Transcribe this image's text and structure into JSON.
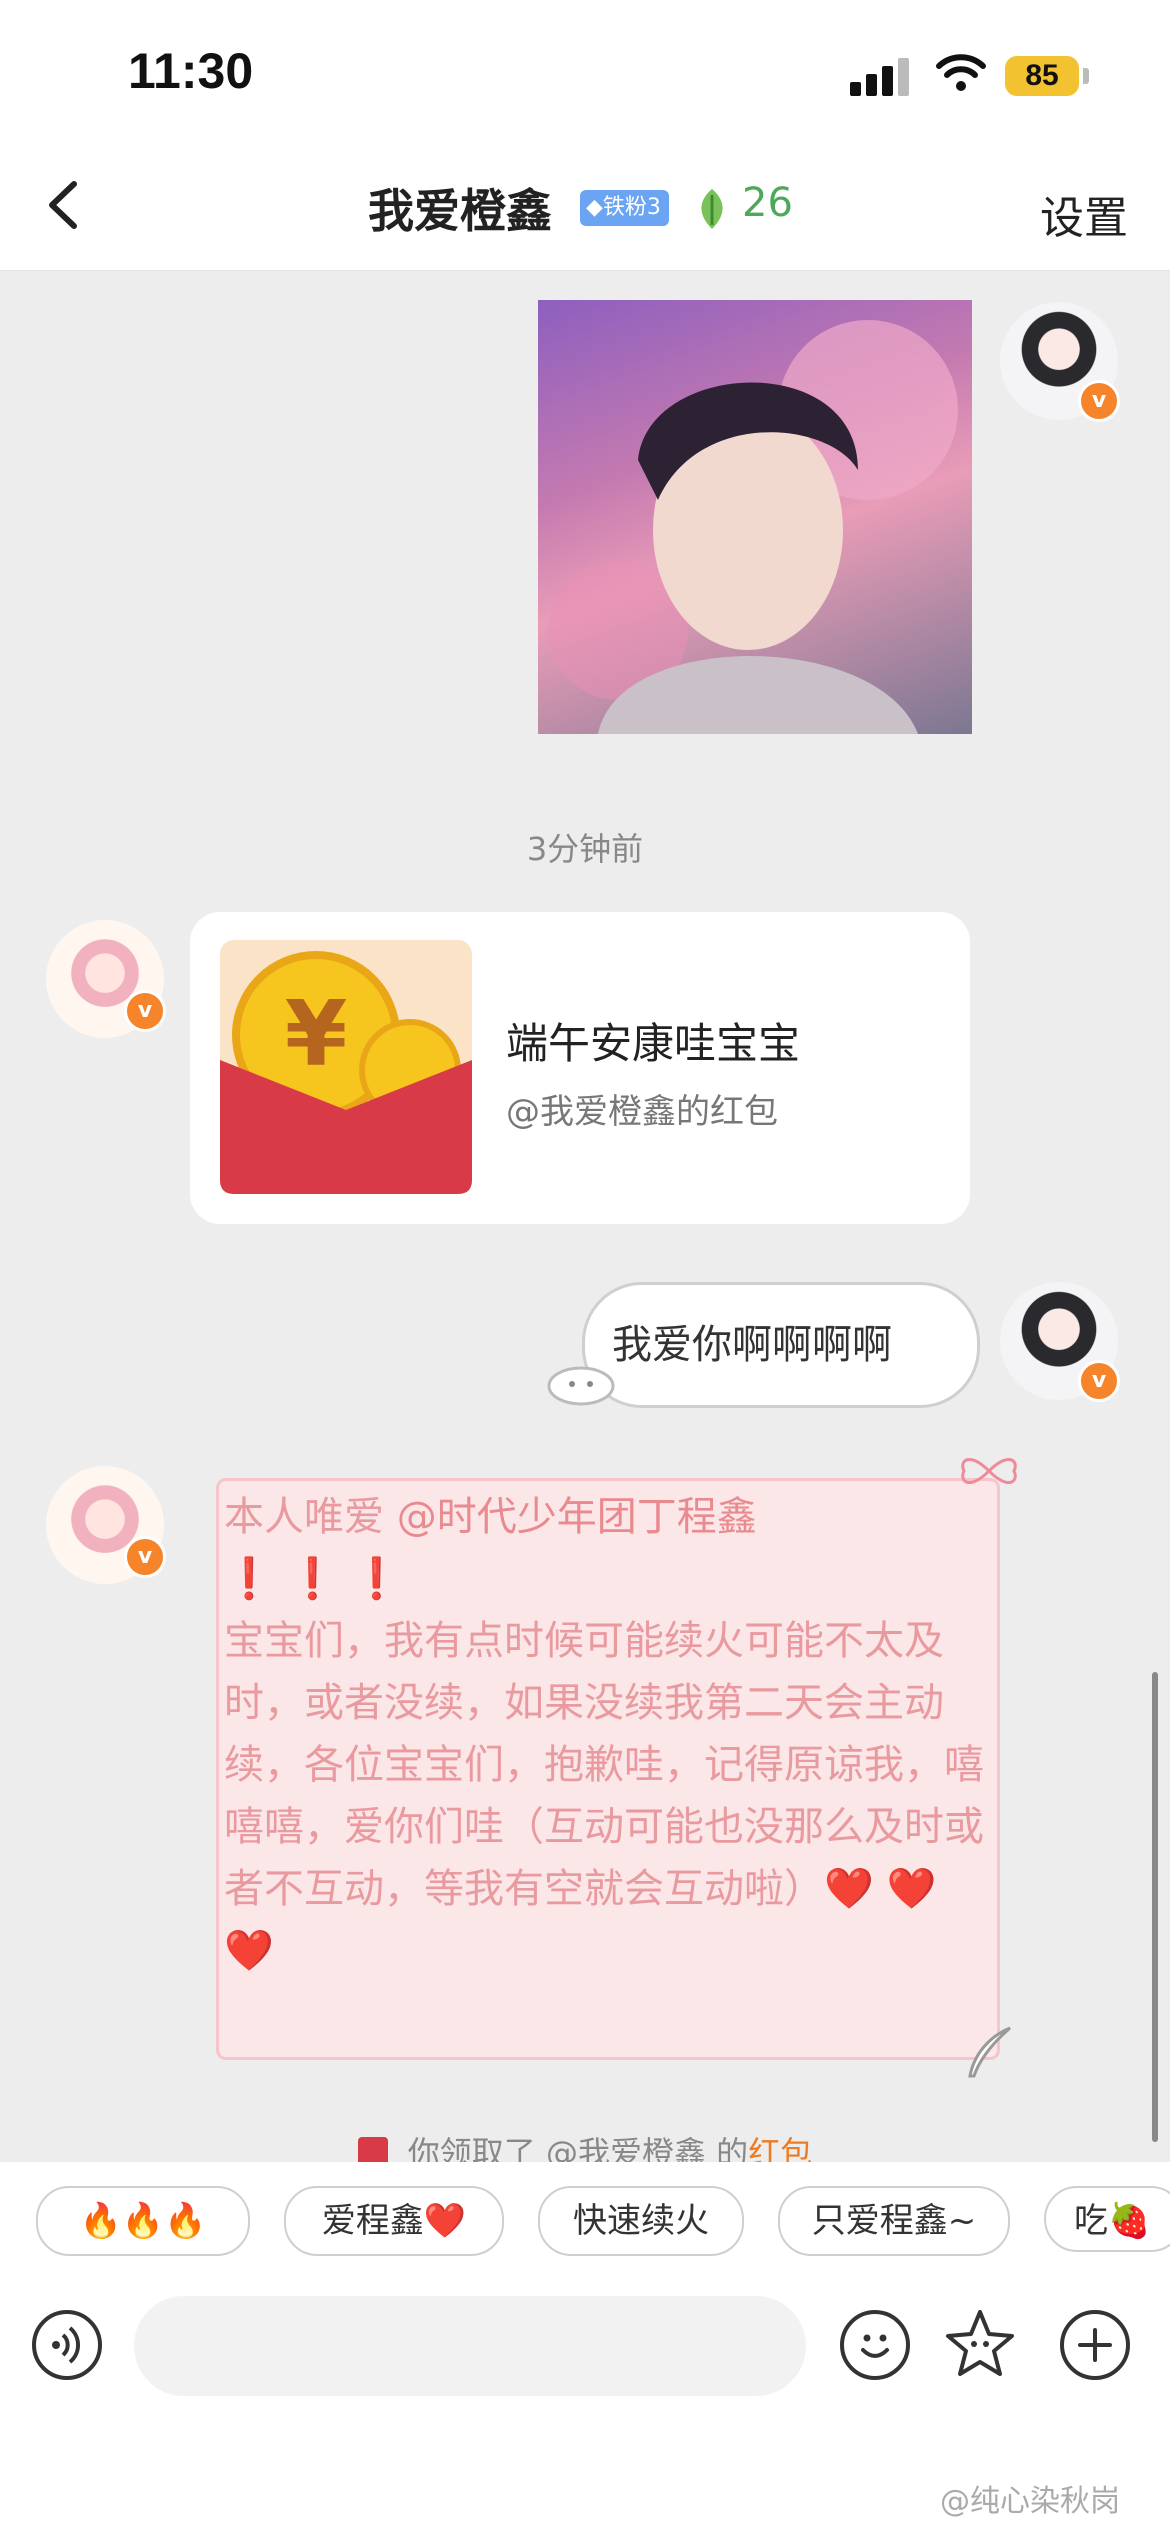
{
  "status_bar": {
    "time": "11:30",
    "battery": "85"
  },
  "header": {
    "back_label": "‹",
    "title": "我爱橙鑫",
    "fan_badge": "铁粉3",
    "leaf_count": "26",
    "settings_label": "设置"
  },
  "messages": {
    "timestamp": "3分钟前",
    "packet": {
      "title": "端午安康哇宝宝",
      "subtitle": "@我爱橙鑫的红包"
    },
    "my_text": "我爱你啊啊啊啊",
    "long": {
      "prefix": "本人唯爱",
      "mention": "@时代少年团丁程鑫",
      "bangs": "❗ ❗ ❗",
      "body": "宝宝们，我有点时候可能续火可能不太及时，或者没续，如果没续我第二天会主动续，各位宝宝们，抱歉哇，记得原谅我，嘻嘻嘻，爱你们哇（互动可能也没那么及时或者不互动，等我有空就会互动啦）",
      "hearts": "❤️ ❤️ ❤️"
    },
    "system_note": {
      "prefix": "你领取了",
      "user": "@我爱橙鑫",
      "middle": " 的",
      "link": "红包"
    }
  },
  "quick_replies": [
    "🔥🔥🔥",
    "爱程鑫❤️",
    "快速续火",
    "只爱程鑫~",
    "吃🍓"
  ],
  "input": {
    "placeholder": ""
  },
  "watermark": "@纯心染秋岗",
  "colors": {
    "accent_orange": "#f5842b",
    "bubble_pink": "#fbe6e8",
    "link_orange": "#ef7b20",
    "leaf_green": "#4ea85a"
  }
}
